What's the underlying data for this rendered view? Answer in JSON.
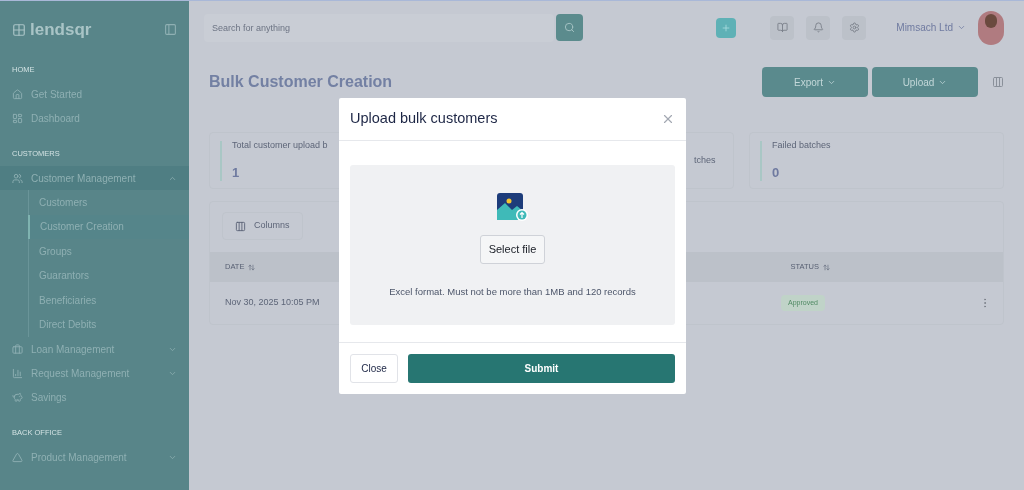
{
  "sidebar": {
    "logo": "lendsqr",
    "sections": [
      {
        "title": "HOME",
        "items": [
          {
            "kind": "link",
            "label": "Get Started"
          },
          {
            "kind": "link",
            "label": "Dashboard"
          }
        ]
      },
      {
        "title": "CUSTOMERS",
        "items": [
          {
            "kind": "group",
            "label": "Customer Management",
            "expanded": true,
            "children": [
              {
                "label": "Customers",
                "selected": false
              },
              {
                "label": "Customer Creation",
                "selected": true
              },
              {
                "label": "Groups",
                "selected": false
              },
              {
                "label": "Guarantors",
                "selected": false
              },
              {
                "label": "Beneficiaries",
                "selected": false
              },
              {
                "label": "Direct Debits",
                "selected": false
              }
            ]
          },
          {
            "kind": "group",
            "label": "Loan Management",
            "expanded": false
          },
          {
            "kind": "group",
            "label": "Request Management",
            "expanded": false
          },
          {
            "kind": "link",
            "label": "Savings"
          }
        ]
      },
      {
        "title": "BACK OFFICE",
        "items": [
          {
            "kind": "group",
            "label": "Product Management",
            "expanded": false
          }
        ]
      }
    ]
  },
  "topbar": {
    "search": {
      "placeholder": "Search for anything"
    },
    "account": "Mimsach Ltd"
  },
  "page": {
    "title": "Bulk Customer Creation",
    "actions": [
      "Export",
      "Upload"
    ],
    "stats": [
      {
        "label": "Total customer upload b",
        "value": "1"
      },
      {
        "label": "tches"
      },
      {
        "label": "Failed batches",
        "value": "0"
      }
    ],
    "table": {
      "toolbar": "Columns",
      "columns": [
        "DATE",
        "STATUS"
      ],
      "rows": [
        {
          "date": "Nov 30, 2025 10:05 PM",
          "status": "Approved"
        }
      ]
    }
  },
  "modal": {
    "title": "Upload bulk customers",
    "select_button": "Select file",
    "hint": "Excel format. Must not be more than 1MB and 120 records",
    "buttons": [
      "Close",
      "Submit"
    ]
  }
}
